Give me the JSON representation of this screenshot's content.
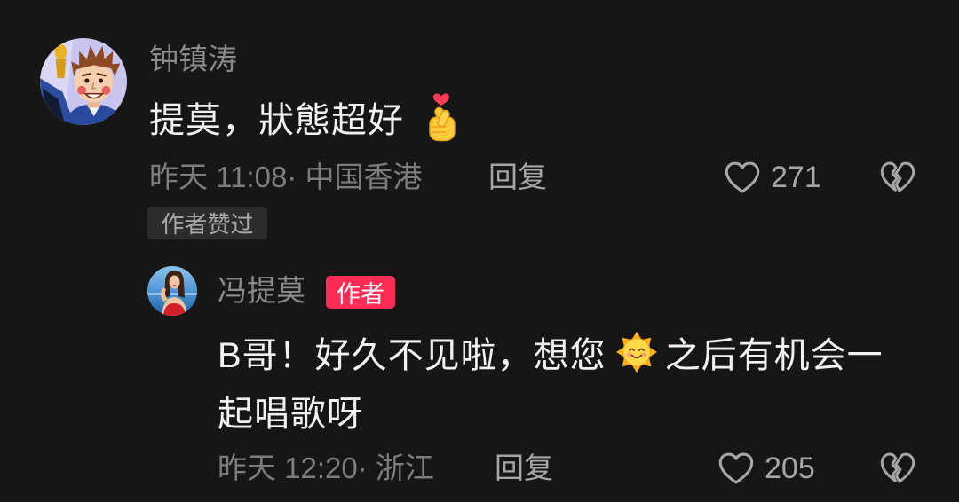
{
  "colors": {
    "background": "#161616",
    "primary_text": "#f1f1f1",
    "secondary_text": "#8a8a8a",
    "author_tag": "#fe2c55"
  },
  "comment": {
    "username": "钟镇涛",
    "text": "提莫，狀態超好",
    "emoji": "finger-heart-emoji",
    "meta": "昨天 11:08· 中国香港",
    "reply_label": "回复",
    "like_icon": "heart-outline-icon",
    "like_count": "271",
    "dislike_icon": "broken-heart-icon",
    "badge": "作者赞过"
  },
  "reply": {
    "username": "冯提莫",
    "author_tag": "作者",
    "text_parts": [
      "B哥！好久不见啦，想您",
      "之后有机会一",
      "起唱歌呀"
    ],
    "emoji": "sun-smile-emoji",
    "meta": "昨天 12:20· 浙江",
    "reply_label": "回复",
    "like_icon": "heart-outline-icon",
    "like_count": "205",
    "dislike_icon": "broken-heart-icon"
  }
}
